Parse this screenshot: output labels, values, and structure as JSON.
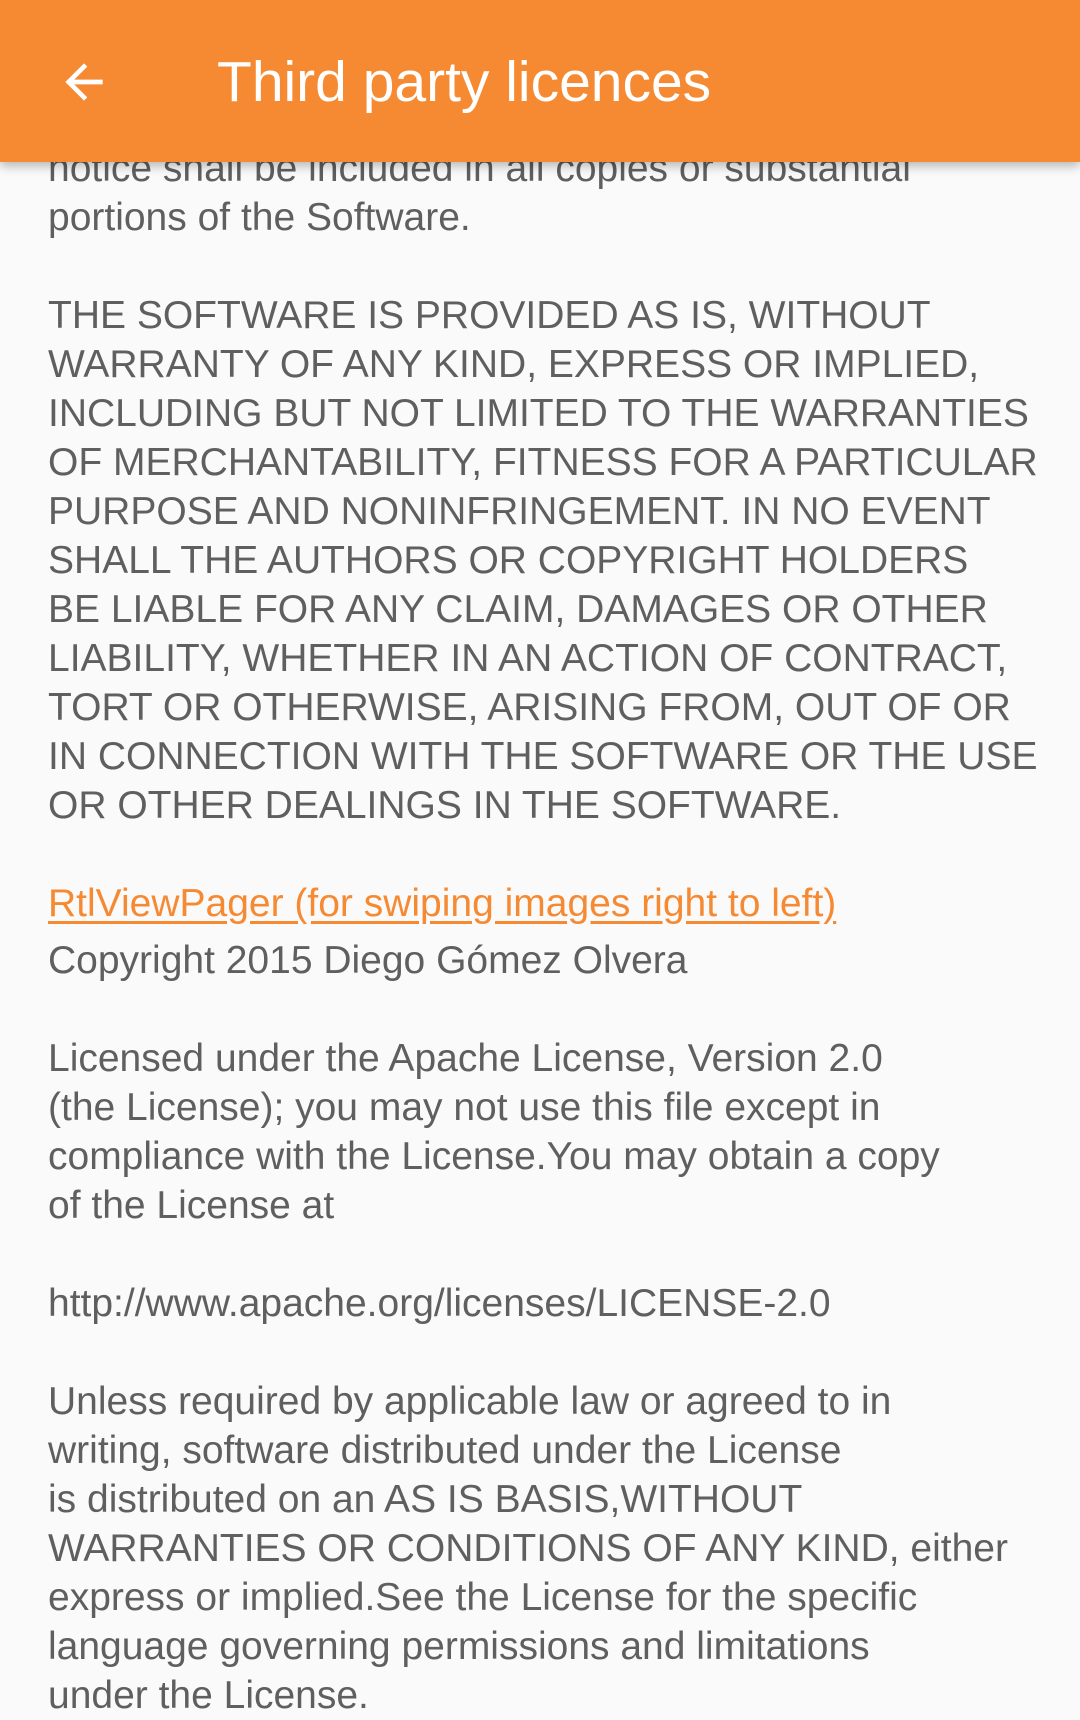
{
  "app_bar": {
    "title": "Third party licences",
    "back_icon": "arrow-left-icon",
    "background": "#f68a33"
  },
  "content": {
    "mit_tail": "notice shall be included in all copies or substantial\nportions of the Software.",
    "mit_warranty": "THE SOFTWARE IS PROVIDED AS IS, WITHOUT\nWARRANTY OF ANY KIND, EXPRESS OR IMPLIED,\nINCLUDING BUT NOT LIMITED TO THE WARRANTIES\nOF MERCHANTABILITY, FITNESS FOR A PARTICULAR\nPURPOSE AND NONINFRINGEMENT. IN NO EVENT\nSHALL THE AUTHORS OR COPYRIGHT HOLDERS\nBE LIABLE FOR ANY CLAIM, DAMAGES OR OTHER\nLIABILITY, WHETHER IN AN ACTION OF CONTRACT,\nTORT OR OTHERWISE, ARISING FROM, OUT OF OR\nIN CONNECTION WITH THE SOFTWARE OR THE USE\nOR OTHER DEALINGS IN THE SOFTWARE.",
    "library_link": "RtlViewPager (for swiping images right to left)",
    "copyright": "Copyright 2015 Diego Gómez Olvera",
    "apache_intro": "Licensed under the Apache License, Version 2.0\n(the License); you may not use this file except in\ncompliance with the License.You may obtain a copy\nof the License at",
    "apache_url": "http://www.apache.org/licenses/LICENSE-2.0",
    "apache_terms": "Unless required by applicable law or agreed to in\nwriting, software distributed under the License\nis distributed on an AS IS BASIS,WITHOUT\nWARRANTIES OR CONDITIONS OF ANY KIND, either\nexpress or implied.See the License for the specific\nlanguage governing permissions and limitations\nunder the License."
  }
}
